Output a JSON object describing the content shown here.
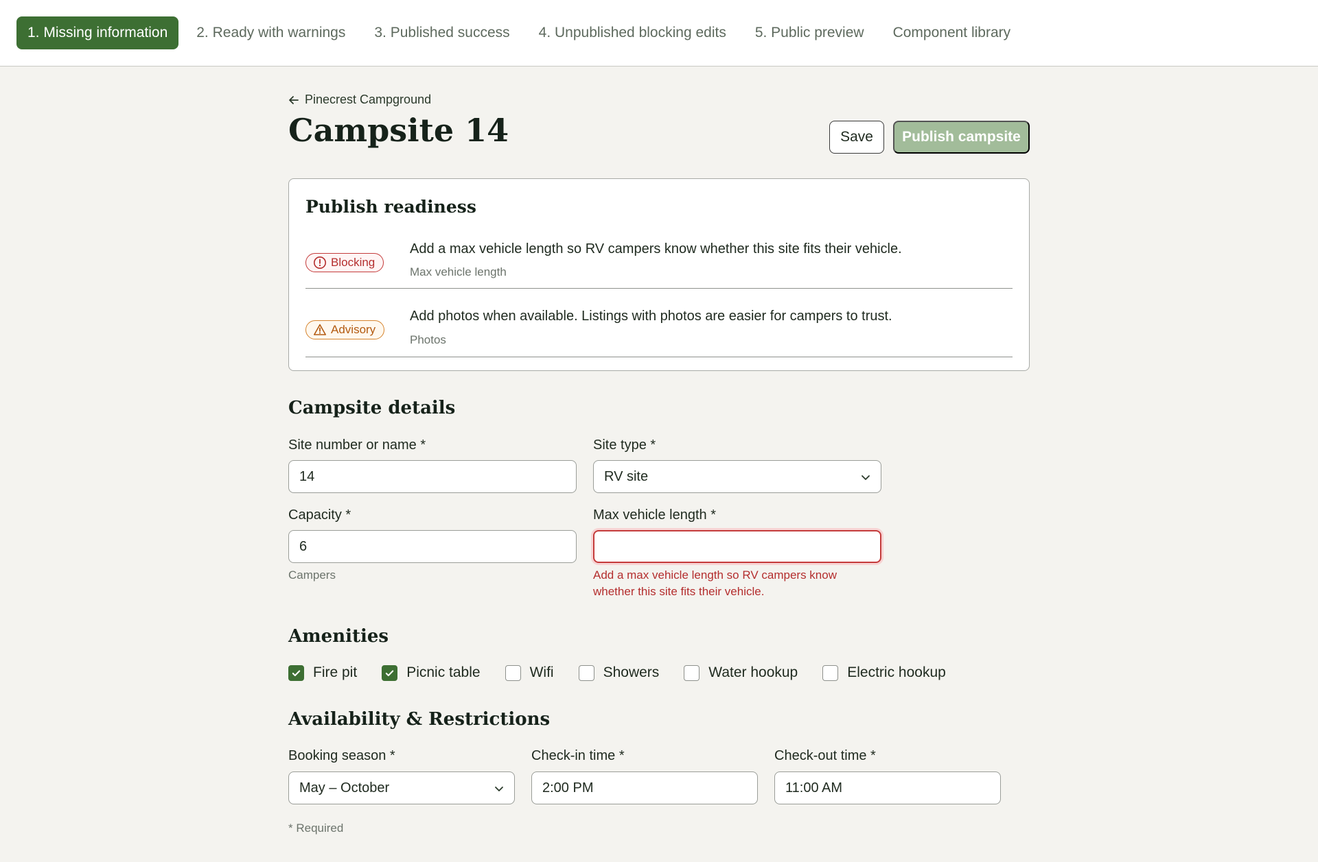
{
  "tabs": [
    {
      "label": "1. Missing information",
      "active": true
    },
    {
      "label": "2. Ready with warnings",
      "active": false
    },
    {
      "label": "3. Published success",
      "active": false
    },
    {
      "label": "4. Unpublished blocking edits",
      "active": false
    },
    {
      "label": "5. Public preview",
      "active": false
    },
    {
      "label": "Component library",
      "active": false
    }
  ],
  "header": {
    "back_label": "Pinecrest Campground",
    "title": "Campsite 14",
    "save_label": "Save",
    "publish_label": "Publish campsite"
  },
  "readiness": {
    "heading": "Publish readiness",
    "items": [
      {
        "badge": "Blocking",
        "message": "Add a max vehicle length so RV campers know whether this site fits their vehicle.",
        "field": "Max vehicle length"
      },
      {
        "badge": "Advisory",
        "message": "Add photos when available. Listings with photos are easier for campers to trust.",
        "field": "Photos"
      }
    ]
  },
  "details": {
    "heading": "Campsite details",
    "site_label": "Site number or name *",
    "site_value": "14",
    "type_label": "Site type *",
    "type_value": "RV site",
    "capacity_label": "Capacity *",
    "capacity_value": "6",
    "capacity_hint": "Campers",
    "vehicle_label": "Max vehicle length *",
    "vehicle_value": "",
    "vehicle_error": "Add a max vehicle length so RV campers know whether this site fits their vehicle."
  },
  "amenities": {
    "heading": "Amenities",
    "items": [
      {
        "label": "Fire pit",
        "checked": true
      },
      {
        "label": "Picnic table",
        "checked": true
      },
      {
        "label": "Wifi",
        "checked": false
      },
      {
        "label": "Showers",
        "checked": false
      },
      {
        "label": "Water hookup",
        "checked": false
      },
      {
        "label": "Electric hookup",
        "checked": false
      }
    ]
  },
  "availability": {
    "heading": "Availability & Restrictions",
    "season_label": "Booking season *",
    "season_value": "May – October",
    "checkin_label": "Check-in time *",
    "checkin_value": "2:00 PM",
    "checkout_label": "Check-out time *",
    "checkout_value": "11:00 AM",
    "required_note": "* Required"
  },
  "colors": {
    "accent": "#3d6f33",
    "blocking": "#b42e2e",
    "advisory": "#b35a10",
    "publish_disabled": "#a2bc9a"
  },
  "icons": {
    "back": "arrow-left-icon",
    "blocking": "alert-circle-icon",
    "advisory": "warning-triangle-icon",
    "select": "chevron-down-icon",
    "checkbox": "check-icon"
  }
}
